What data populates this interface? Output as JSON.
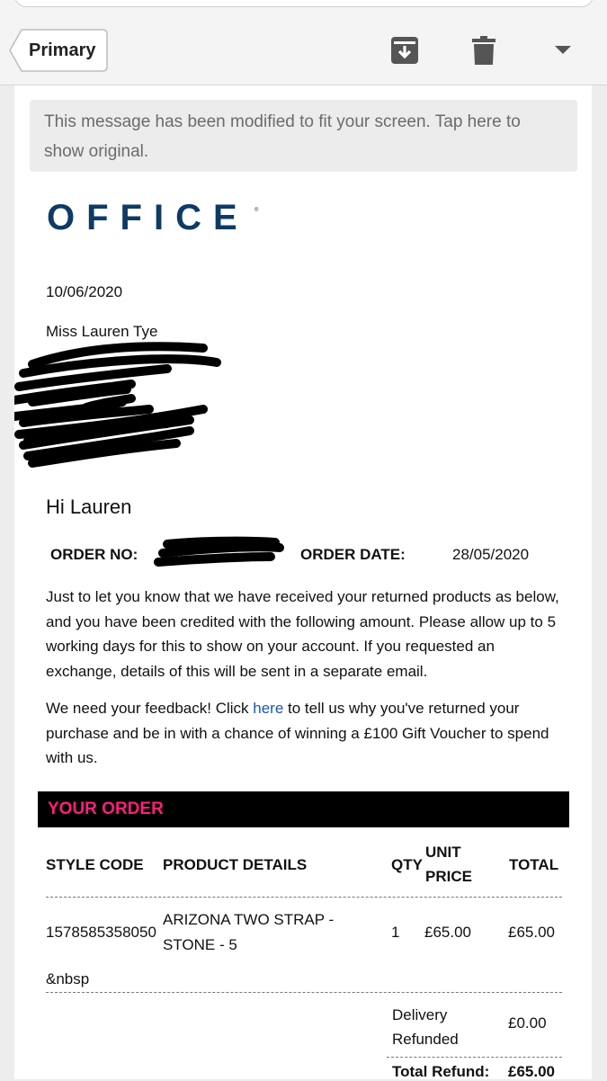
{
  "toolbar": {
    "folder_label": "Primary",
    "icons": [
      "archive-icon",
      "trash-icon",
      "dropdown-icon"
    ]
  },
  "notice": {
    "text": "This message has been modified to fit your screen. Tap here to show original."
  },
  "brand": {
    "logo_text": "OFFICE",
    "color": "#0e3a66"
  },
  "email": {
    "date": "10/06/2020",
    "recipient_name": "Miss Lauren Tye",
    "greeting": "Hi Lauren",
    "order_no_label": "ORDER NO:",
    "order_date_label": "ORDER DATE:",
    "order_date_value": "28/05/2020",
    "para1": "Just to let you know that we have received your returned products as below, and you have been credited with the following amount. Please allow up to 5 working days for this to show on your account. If you requested an exchange, details of this will be sent in a separate email.",
    "para2_before": "We need your feedback! Click ",
    "para2_link": "here",
    "para2_after": " to tell us why you've returned your purchase and be in with a chance of winning a £100 Gift Voucher to spend with us."
  },
  "order": {
    "section_title": "YOUR ORDER",
    "section_title_color": "#ff1f7a",
    "headers": {
      "style_code": "STYLE CODE",
      "product_details": "PRODUCT DETAILS",
      "qty": "QTY",
      "unit_price_1": "UNIT",
      "unit_price_2": "PRICE",
      "total": "TOTAL"
    },
    "rows": [
      {
        "style_code": "1578585358050",
        "product_line1": "ARIZONA TWO STRAP -",
        "product_line2": "STONE - 5",
        "qty": "1",
        "unit_price": "£65.00",
        "total": "£65.00"
      }
    ],
    "nbsp_text": "&nbsp",
    "delivery_label_1": "Delivery",
    "delivery_label_2": "Refunded",
    "delivery_value": "£0.00",
    "total_refund_label": "Total Refund:",
    "total_refund_value": "£65.00"
  }
}
